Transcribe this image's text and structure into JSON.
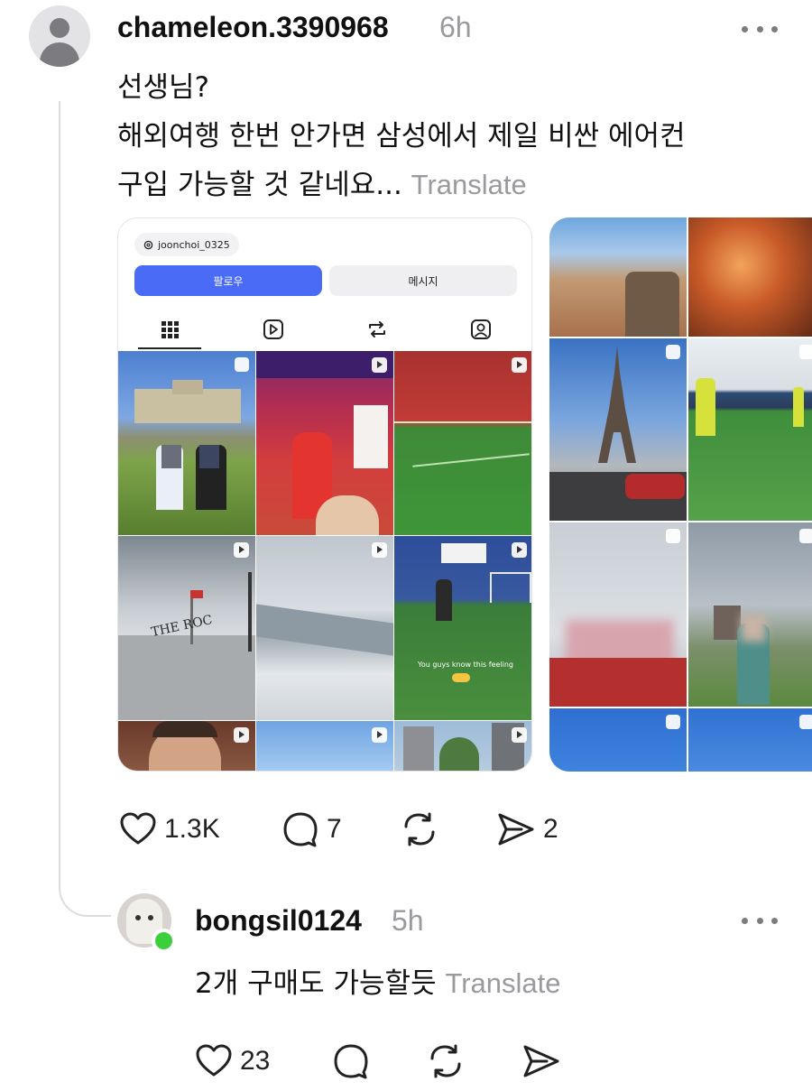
{
  "post": {
    "username": "chameleon.3390968",
    "time": "6h",
    "text_lines": [
      "선생님?",
      "해외여행 한번 안가면 삼성에서 제일 비싼 에어컨",
      "구입 가능할 것 같네요..."
    ],
    "translate_label": "Translate",
    "card1": {
      "handle": "joonchoi_0325",
      "follow_label": "팔로우",
      "message_label": "메시지",
      "tile_texts": {
        "rock_sign": "THE ROC",
        "soccer_caption": "You guys know this feeling"
      }
    },
    "stats": {
      "likes": "1.3K",
      "comments": "7",
      "reposts": "",
      "shares": "2"
    }
  },
  "reply": {
    "username": "bongsil0124",
    "time": "5h",
    "text": "2개 구매도 가능할듯",
    "translate_label": "Translate",
    "stats": {
      "likes": "23"
    }
  },
  "colors": {
    "accent_button": "#4a6bf5",
    "online": "#3ccf3c",
    "muted_text": "#9a9a9e"
  },
  "icons": [
    "heart-icon",
    "comment-icon",
    "repost-icon",
    "share-icon",
    "more-icon",
    "threads-icon",
    "grid-icon",
    "reels-icon",
    "tagged-icon"
  ]
}
